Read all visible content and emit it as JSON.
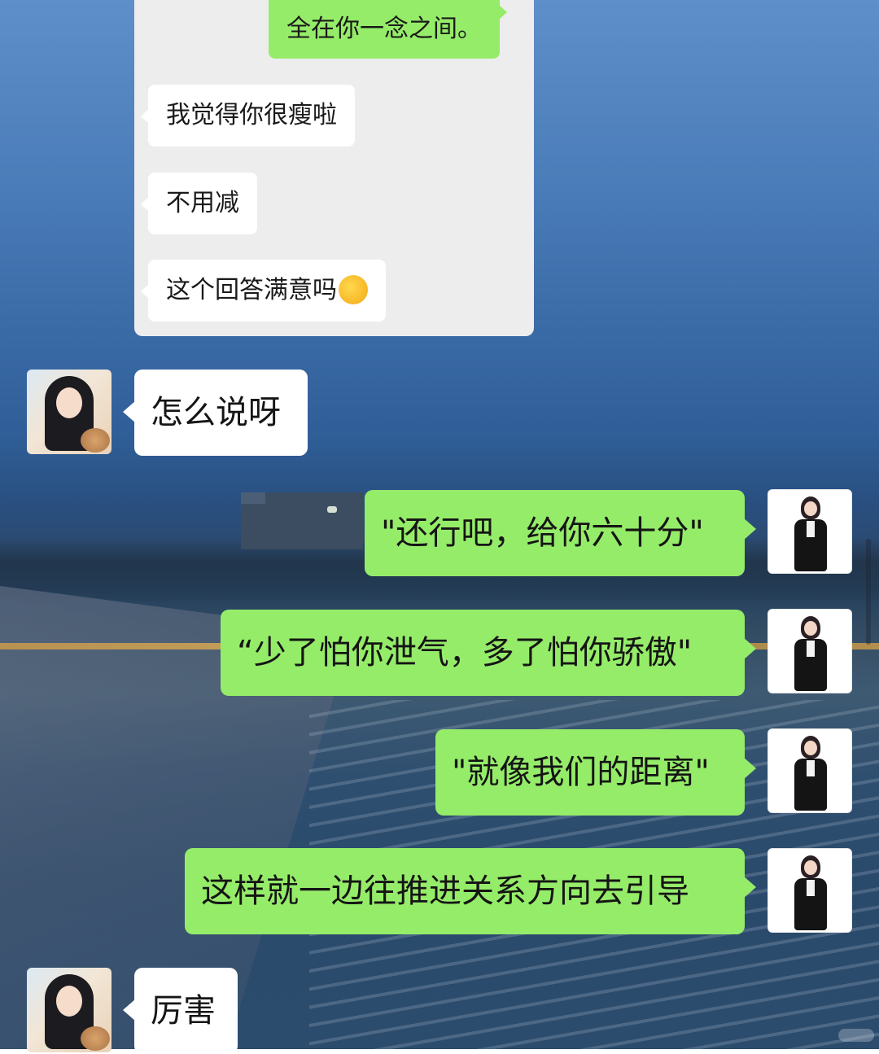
{
  "quoted_chat": {
    "messages": [
      {
        "side": "right",
        "text": "全在你一念之间。"
      },
      {
        "side": "left",
        "text": "我觉得你很瘦啦"
      },
      {
        "side": "left",
        "text": "不用减"
      },
      {
        "side": "left",
        "text": "这个回答满意吗",
        "emoji": "thinking-face-emoji"
      }
    ]
  },
  "chat": {
    "messages": [
      {
        "side": "left",
        "avatar": "girl-avatar",
        "text": "怎么说呀"
      },
      {
        "side": "right",
        "avatar": "woman-avatar",
        "text": "\"还行吧，给你六十分\""
      },
      {
        "side": "right",
        "avatar": "woman-avatar",
        "text": "“少了怕你泄气，多了怕你骄傲\""
      },
      {
        "side": "right",
        "avatar": "woman-avatar",
        "text": "\"就像我们的距离\""
      },
      {
        "side": "right",
        "avatar": "woman-avatar",
        "text": "这样就一边往推进关系方向去引导"
      },
      {
        "side": "left",
        "avatar": "girl-avatar",
        "text": "厉害"
      }
    ]
  },
  "colors": {
    "sent_bubble": "#95ec69",
    "received_bubble": "#ffffff",
    "quoted_panel": "#ededed"
  }
}
